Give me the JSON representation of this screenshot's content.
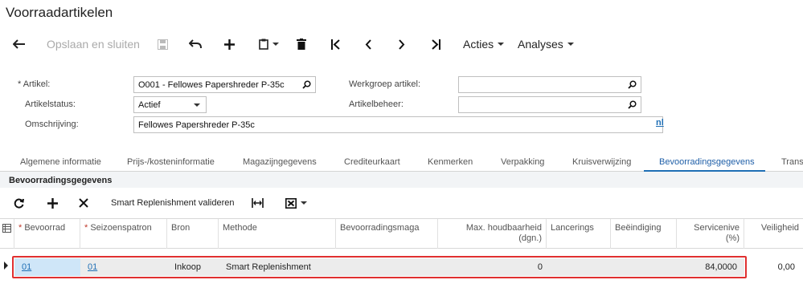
{
  "page": {
    "title": "Voorraadartikelen"
  },
  "toolbar": {
    "save_close_label": "Opslaan en sluiten",
    "actions_label": "Acties",
    "analyses_label": "Analyses"
  },
  "form": {
    "article_label": "Artikel:",
    "article_required": "*",
    "article_value": "O001 - Fellowes Papershreder P-35c",
    "status_label": "Artikelstatus:",
    "status_value": "Actief",
    "description_label": "Omschrijving:",
    "description_value": "Fellowes Papershreder P-35c",
    "workgroup_label": "Werkgroep artikel:",
    "workgroup_value": "",
    "manager_label": "Artikelbeheer:",
    "manager_value": "",
    "language_link": "nl"
  },
  "tabs": [
    {
      "label": "Algemene informatie"
    },
    {
      "label": "Prijs-/kosteninformatie"
    },
    {
      "label": "Magazijngegevens"
    },
    {
      "label": "Crediteurkaart"
    },
    {
      "label": "Kenmerken"
    },
    {
      "label": "Verpakking"
    },
    {
      "label": "Kruisverwijzing"
    },
    {
      "label": "Bevoorradingsgegevens"
    },
    {
      "label": "Trans"
    }
  ],
  "section": {
    "title": "Bevoorradingsgegevens"
  },
  "grid_toolbar": {
    "validate_label": "Smart Replenishment valideren"
  },
  "grid": {
    "required_marker": "*",
    "columns": [
      "Bevoorrad",
      "Seizoenspatron",
      "Bron",
      "Methode",
      "Bevoorradingsmaga",
      "Max. houdbaarheid (dgn.)",
      "Lancerings",
      "Beëindiging",
      "Servicenive (%)",
      "Veiligheid"
    ],
    "rows": [
      [
        "01",
        "01",
        "Inkoop",
        "Smart Replenishment",
        "",
        "0",
        "",
        "",
        "84,0000",
        "0,00"
      ]
    ]
  },
  "colors": {
    "accent": "#1f6fb5",
    "highlight": "#e03030",
    "selected_cell": "#cfe6f8"
  }
}
